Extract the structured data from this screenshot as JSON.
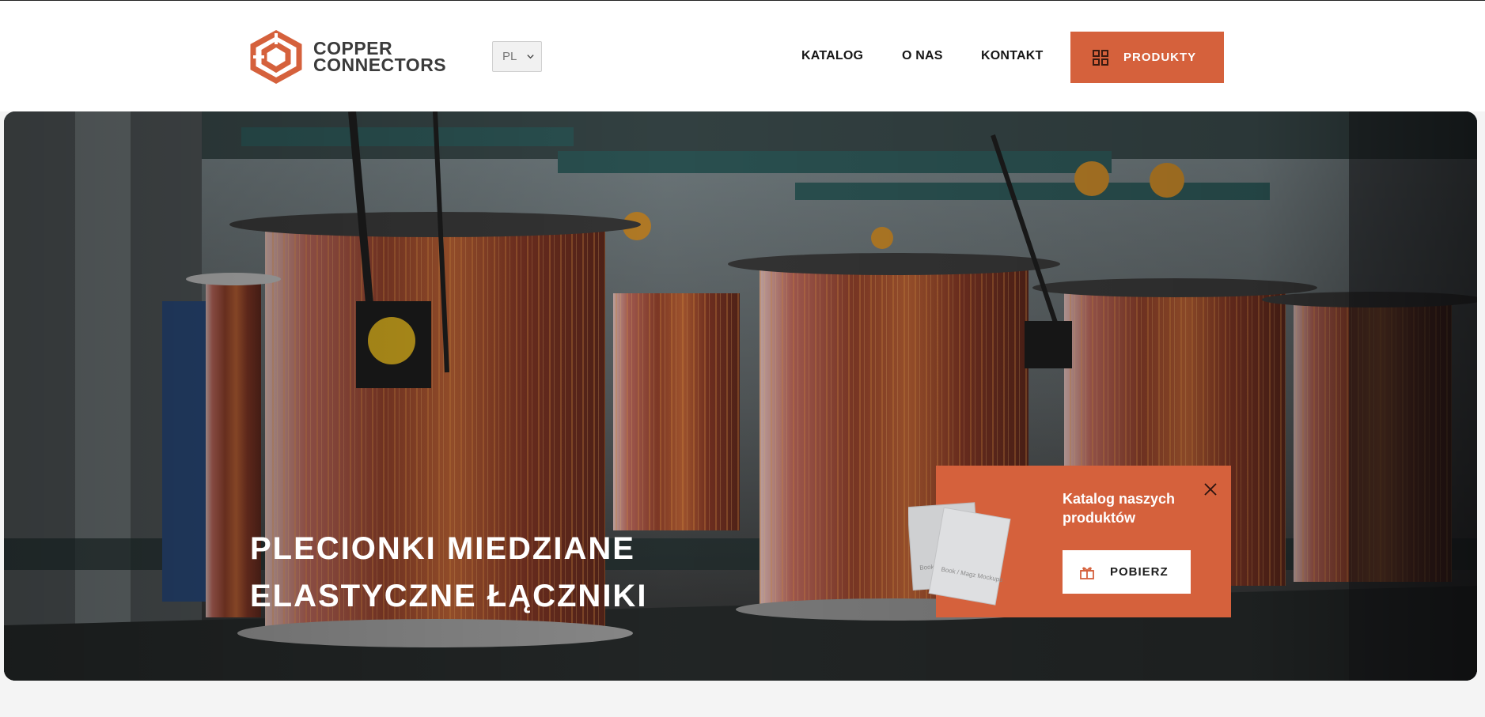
{
  "brand": {
    "name_line1": "COPPER",
    "name_line2": "CONNECTORS",
    "accent_color": "#d5613c",
    "logo_icon": "copper-connectors-logo-mark"
  },
  "language": {
    "selected": "PL"
  },
  "nav": {
    "items": [
      {
        "label": "KATALOG"
      },
      {
        "label": "O NAS"
      },
      {
        "label": "KONTAKT"
      }
    ],
    "products_button": {
      "label": "PRODUKTY",
      "icon": "grid-icon"
    }
  },
  "hero": {
    "title_line1": "PLECIONKI MIEDZIANE",
    "title_line2": "ELASTYCZNE ŁĄCZNIKI",
    "background": "copper-wire-spools-photo"
  },
  "catalog_popup": {
    "title": "Katalog naszych produktów",
    "download_label": "POBIERZ",
    "download_icon": "gift-box-icon",
    "close_icon": "close-icon",
    "mockup_text_back": "Book / Mag",
    "mockup_text_front": "Book / Magz Mockups"
  }
}
